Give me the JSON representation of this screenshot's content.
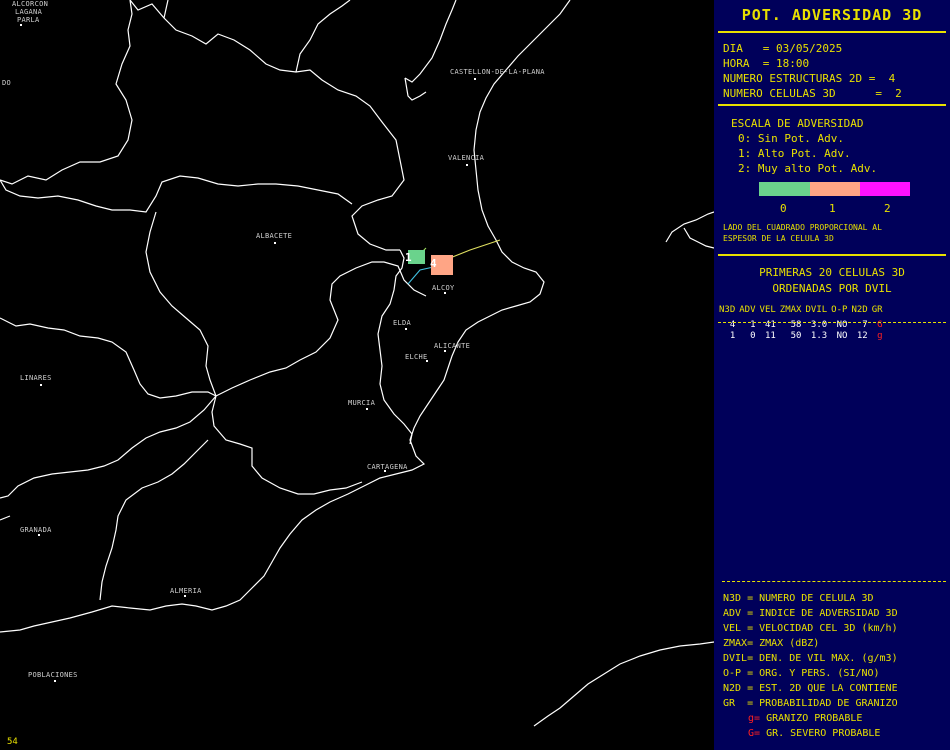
{
  "panel": {
    "title": "POT. ADVERSIDAD 3D",
    "dia": "DIA   = 03/05/2025",
    "hora": "HORA  = 18:00",
    "num_estructuras": "NUMERO ESTRUCTURAS 2D =  4",
    "num_celulas": "NUMERO CELULAS 3D      =  2",
    "escala_title": "ESCALA DE ADVERSIDAD",
    "escala_0": "0: Sin Pot. Adv.",
    "escala_1": "1: Alto Pot. Adv.",
    "escala_2": "2: Muy alto Pot. Adv.",
    "scale_colors": [
      "#6ad38c",
      "#ffa585",
      "#ff11ff"
    ],
    "scale_labels": [
      "0",
      "1",
      "2"
    ],
    "note_1": "LADO DEL CUADRADO PROPORCIONAL AL",
    "note_2": "ESPESOR DE LA CELULA 3D",
    "cells_title_1": "PRIMERAS 20 CELULAS 3D",
    "cells_title_2": "ORDENADAS POR DVIL",
    "columns": [
      "N3D",
      "ADV",
      "VEL",
      "ZMAX",
      "DVIL",
      "O-P",
      "N2D",
      "GR"
    ],
    "rows": [
      [
        "4",
        "1",
        "41",
        "58",
        "3.0",
        "NO",
        "7",
        "G"
      ],
      [
        "1",
        "0",
        "11",
        "50",
        "1.3",
        "NO",
        "12",
        "g"
      ]
    ],
    "legend": [
      "N3D = NUMERO DE CELULA 3D",
      "ADV = INDICE DE ADVERSIDAD 3D",
      "VEL = VELOCIDAD CEL 3D (km/h)",
      "ZMAX= ZMAX (dBZ)",
      "DVIL= DEN. DE VIL MAX. (g/m3)",
      "O-P = ORG. Y PERS. (SI/NO)",
      "N2D = EST. 2D QUE LA CONTIENE",
      "GR  = PROBABILIDAD DE GRANIZO"
    ],
    "gr_g_key": "g=",
    "gr_g_text": " GRANIZO PROBABLE",
    "gr_G_key": "G=",
    "gr_G_text": " GR. SEVERO PROBABLE"
  },
  "map": {
    "cities": [
      "ALCORCON",
      "LAGANA",
      "PARLA",
      "DO",
      "CASTELLON-DE-LA-PLANA",
      "VALENCIA",
      "ALBACETE",
      "ALCOY",
      "ELDA",
      "ELCHE",
      "ALICANTE",
      "LINARES",
      "MURCIA",
      "CARTAGENA",
      "GRANADA",
      "ALMERIA",
      "POBLACIONES"
    ],
    "cell_labels": [
      "1",
      "4"
    ],
    "frame_number": "54"
  }
}
